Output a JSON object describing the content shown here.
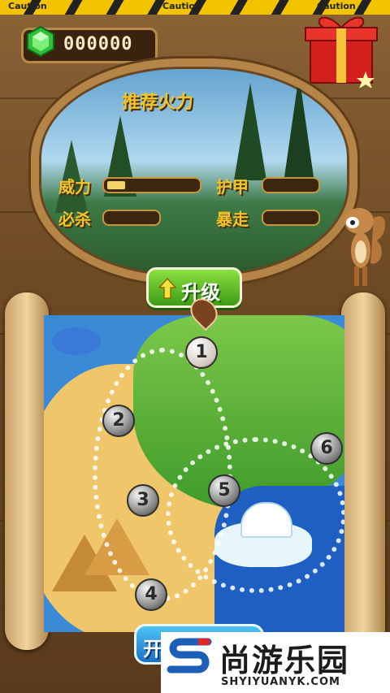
{
  "hud": {
    "tape_text": "Caution",
    "gems": "000000"
  },
  "stats": {
    "title": "推荐火力",
    "items": [
      {
        "label": "威力",
        "level": 0.2
      },
      {
        "label": "护甲",
        "level": 0
      },
      {
        "label": "必杀",
        "level": 0
      },
      {
        "label": "暴走",
        "level": 0
      }
    ]
  },
  "buttons": {
    "upgrade": "升级",
    "start": "开始游戏"
  },
  "map": {
    "levels": [
      "1",
      "2",
      "3",
      "4",
      "5",
      "6"
    ],
    "current_level": "1"
  },
  "watermark": {
    "cn": "尚游乐园",
    "en": "SHYIYUANYK.COM"
  }
}
